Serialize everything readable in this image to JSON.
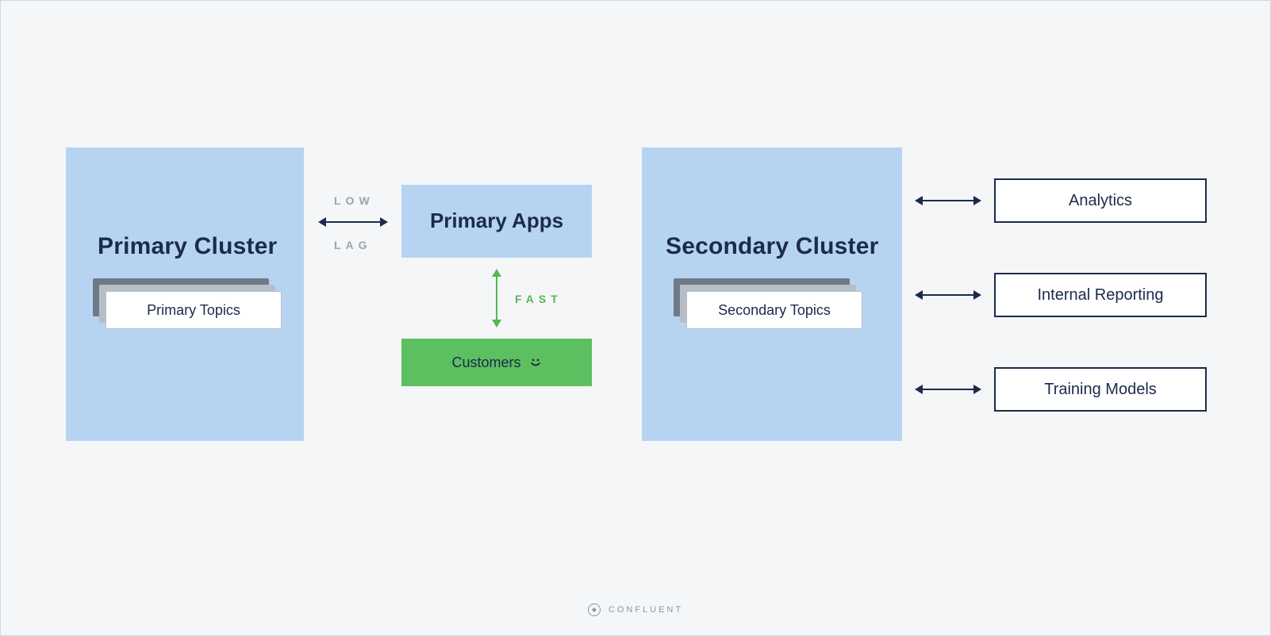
{
  "primary_cluster": {
    "title": "Primary Cluster",
    "topics_label": "Primary Topics"
  },
  "primary_apps": {
    "title": "Primary Apps"
  },
  "annotations": {
    "low": "LOW",
    "lag": "LAG",
    "fast": "FAST"
  },
  "customers": {
    "label": "Customers"
  },
  "secondary_cluster": {
    "title": "Secondary Cluster",
    "topics_label": "Secondary Topics"
  },
  "consumers": {
    "analytics": "Analytics",
    "internal_reporting": "Internal Reporting",
    "training_models": "Training Models"
  },
  "footer": {
    "brand": "CONFLUENT"
  },
  "colors": {
    "light_blue": "#b6d3f2",
    "dark_navy": "#1c2b4a",
    "green": "#5cbf60",
    "gray_text": "#9aa4af",
    "bg": "#f5f6f7"
  }
}
